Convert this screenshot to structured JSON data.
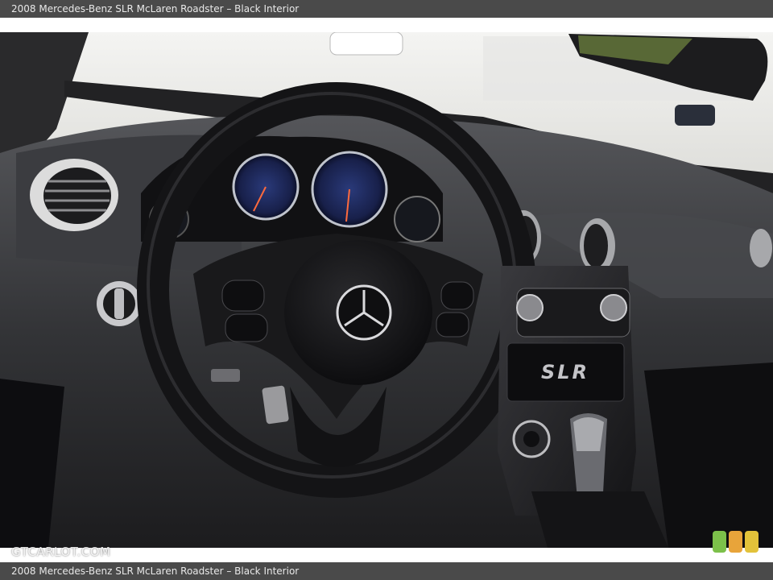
{
  "caption": {
    "top": "2008 Mercedes-Benz SLR McLaren Roadster – Black Interior",
    "bottom": "2008 Mercedes-Benz SLR McLaren Roadster – Black Interior"
  },
  "watermark": "GTCARLOT.COM",
  "console_badge": "SLR",
  "colors": {
    "bar": "#4a4a4a",
    "badge_green": "#7cc04a",
    "badge_orange": "#e8a43a",
    "badge_yellow": "#e2c23a"
  }
}
